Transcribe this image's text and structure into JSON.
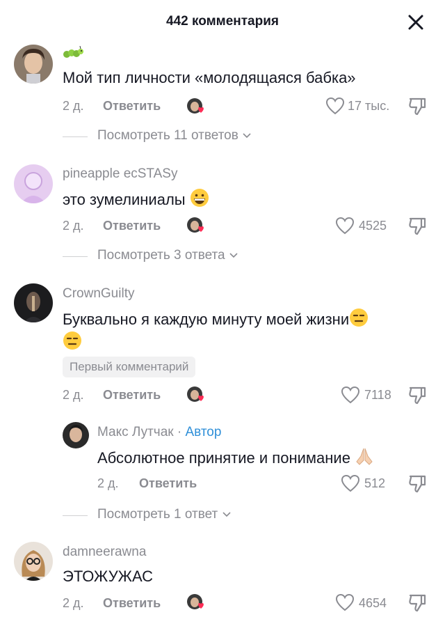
{
  "header": {
    "title": "442 комментария"
  },
  "comments": [
    {
      "username": "",
      "username_emoji": "caterpillar-emoji",
      "text": "Мой тип личности «молодящаяся бабка»",
      "time": "2 д.",
      "reply_label": "Ответить",
      "likes": "17 тыс.",
      "view_replies": "Посмотреть 11 ответов"
    },
    {
      "username": "pineapple ecSTASy",
      "text": "это зумелиниалы",
      "text_emoji": "grinning-face-emoji",
      "time": "2 д.",
      "reply_label": "Ответить",
      "likes": "4525",
      "view_replies": "Посмотреть 3 ответа"
    },
    {
      "username": "CrownGuilty",
      "text": "Буквально я каждую минуту моей жизни",
      "text_emoji": "expressionless-face-emoji",
      "badge": "Первый комментарий",
      "time": "2 д.",
      "reply_label": "Ответить",
      "likes": "7118",
      "reply": {
        "username": "Макс Лутчак",
        "separator": "·",
        "author_label": "Автор",
        "text": "Абсолютное принятие и понимание",
        "text_emoji": "folded-hands-emoji",
        "time": "2 д.",
        "reply_label": "Ответить",
        "likes": "512"
      },
      "view_replies": "Посмотреть 1 ответ"
    },
    {
      "username": "damneerawna",
      "text": "ЭТОЖУЖАС",
      "time": "2 д.",
      "reply_label": "Ответить",
      "likes": "4654"
    }
  ],
  "colors": {
    "text": "#161823",
    "muted": "#8a8b91",
    "author": "#2f8fd8",
    "heart": "#fe2c55"
  }
}
